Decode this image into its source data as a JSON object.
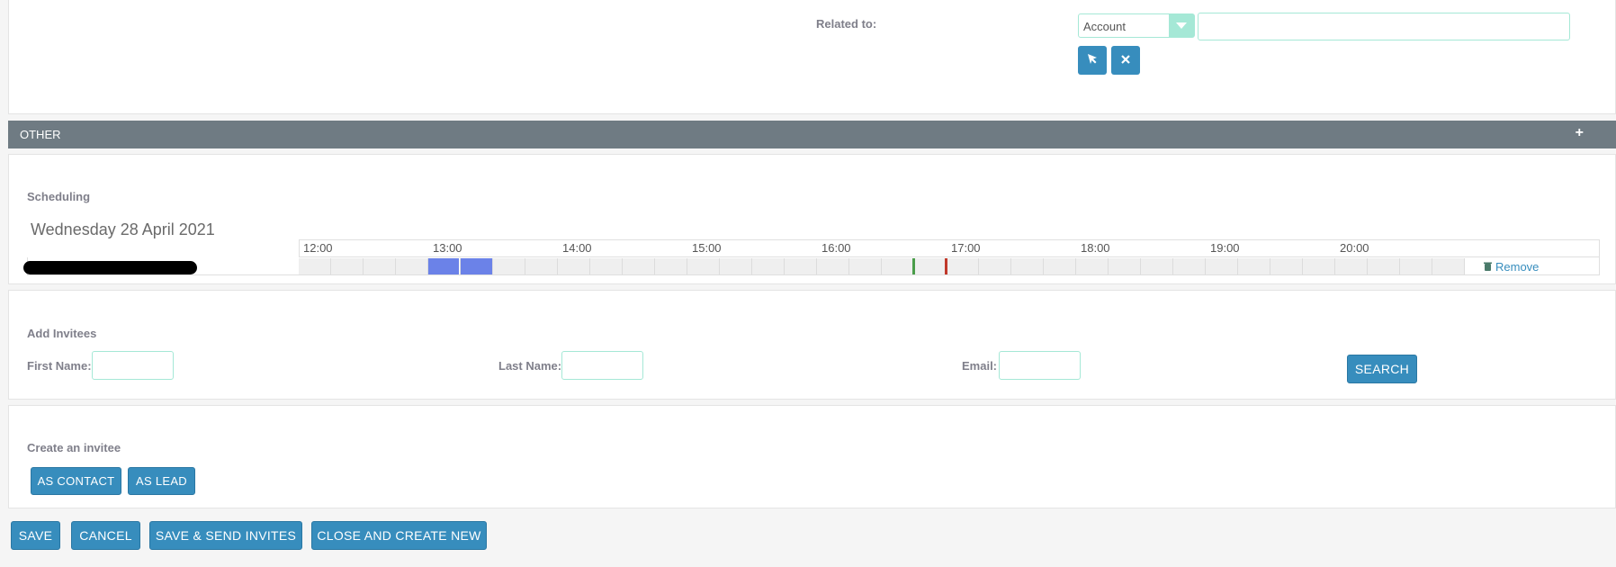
{
  "related": {
    "label": "Related to:",
    "type_value": "Account",
    "name_value": ""
  },
  "other": {
    "title": "OTHER",
    "toggle": "+"
  },
  "scheduling": {
    "title": "Scheduling",
    "date": "Wednesday 28 April 2021",
    "hours": [
      "12:00",
      "13:00",
      "14:00",
      "15:00",
      "16:00",
      "17:00",
      "18:00",
      "19:00",
      "20:00"
    ],
    "remove_label": "Remove",
    "busy_color": "#6b82e8",
    "start_marker_color": "#4a9d4a",
    "end_marker_color": "#c0392b"
  },
  "invitees": {
    "title": "Add Invitees",
    "first_name_label": "First Name:",
    "last_name_label": "Last Name:",
    "email_label": "Email:",
    "search_label": "SEARCH"
  },
  "create": {
    "title": "Create an invitee",
    "as_contact": "AS CONTACT",
    "as_lead": "AS LEAD"
  },
  "footer": {
    "save": "SAVE",
    "cancel": "CANCEL",
    "save_send": "SAVE & SEND INVITES",
    "close_new": "CLOSE AND CREATE NEW"
  },
  "colors": {
    "primary": "#378dbd",
    "header_bar": "#6f7b83",
    "input_border": "#a5e8d6"
  },
  "icons": {
    "select": "cursor-arrow-icon",
    "clear": "close-icon",
    "remove": "trash-icon"
  }
}
